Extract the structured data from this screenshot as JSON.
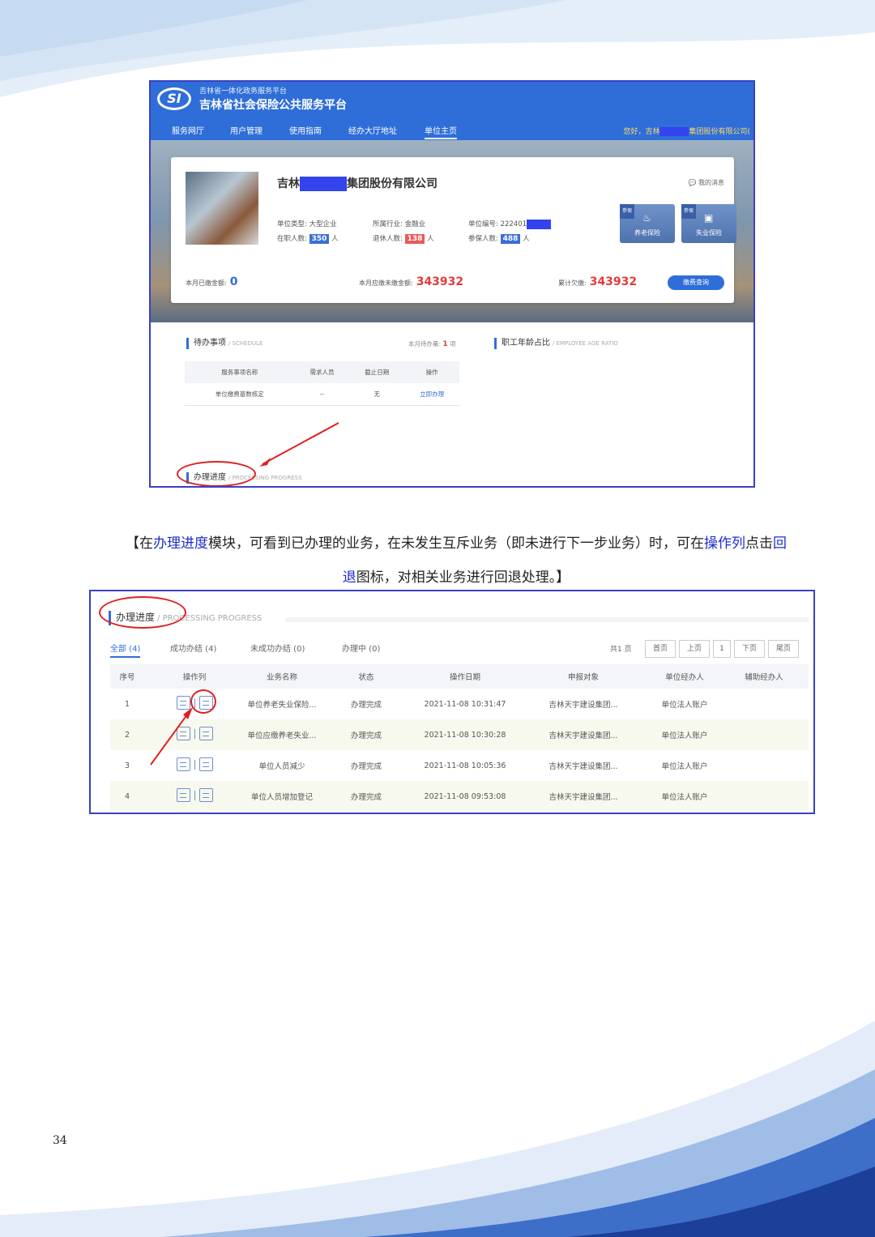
{
  "platform": {
    "subtitle": "吉林省一体化政务服务平台",
    "title": "吉林省社会保险公共服务平台",
    "logo_text": "SI"
  },
  "nav": [
    "服务网厅",
    "用户管理",
    "使用指南",
    "经办大厅地址",
    "单位主页"
  ],
  "greeting": {
    "prefix": "您好，吉林",
    "suffix": "集团股份有限公司("
  },
  "company": {
    "name_prefix": "吉林",
    "name_suffix": "集团股份有限公司",
    "my_message": "我的消息",
    "type_label": "单位类型:",
    "type_value": "大型企业",
    "industry_label": "所属行业:",
    "industry_value": "金融业",
    "code_label": "单位编号:",
    "code_value": "222401",
    "employees_label": "在职人数:",
    "employees_value": "350",
    "person_unit": "人",
    "retired_label": "退休人数:",
    "retired_value": "138",
    "insured_label": "参保人数:",
    "insured_value": "488"
  },
  "insurance_buttons": [
    {
      "label": "养老保险",
      "tag": "参保"
    },
    {
      "label": "失业保险",
      "tag": "参保"
    }
  ],
  "amounts": {
    "paid_label": "本月已缴金额:",
    "paid_value": "0",
    "due_label": "本月应缴未缴金额:",
    "due_value": "343932",
    "arrears_label": "累计欠缴:",
    "arrears_value": "343932",
    "query_btn": "缴费查询"
  },
  "schedule": {
    "title": "待办事项",
    "en": "/ SCHEDULE",
    "count_label": "本月待办量:",
    "count": "1",
    "count_unit": "项",
    "headers": [
      "服务事项名称",
      "需求人员",
      "截止日期",
      "操作"
    ],
    "row": [
      "单位缴费基数核定",
      "--",
      "无",
      "立即办理"
    ]
  },
  "age_ratio": {
    "title": "职工年龄占比",
    "en": "/ EMPLOYEE AGE RATIO"
  },
  "progress1": {
    "title": "办理进度",
    "en": "/ PROCESSING PROGRESS"
  },
  "caption": {
    "line1_parts": [
      "【在",
      "办理进度",
      "模块，可看到已办理的业务，在未发生互斥业务（即未进行下一步业务）时，可在",
      "操作列",
      "点击",
      "回"
    ],
    "line2_parts": [
      "退",
      "图标，对相关业务进行回退处理。】"
    ]
  },
  "progress2": {
    "title": "办理进度",
    "en": "/ PROCESSING PROGRESS",
    "tabs": [
      "全部 (4)",
      "成功办结 (4)",
      "未成功办结 (0)",
      "办理中 (0)"
    ],
    "pager": {
      "total": "共1 页",
      "first": "首页",
      "prev": "上页",
      "page": "1",
      "next": "下页",
      "last": "尾页"
    },
    "headers": [
      "序号",
      "操作列",
      "业务名称",
      "状态",
      "操作日期",
      "申报对象",
      "单位经办人",
      "辅助经办人"
    ],
    "rows": [
      [
        "1",
        "",
        "单位养老失业保险...",
        "办理完成",
        "2021-11-08 10:31:47",
        "吉林天宇建设集团...",
        "单位法人账户",
        ""
      ],
      [
        "2",
        "",
        "单位应缴养老失业...",
        "办理完成",
        "2021-11-08 10:30:28",
        "吉林天宇建设集团...",
        "单位法人账户",
        ""
      ],
      [
        "3",
        "",
        "单位人员减少",
        "办理完成",
        "2021-11-08 10:05:36",
        "吉林天宇建设集团...",
        "单位法人账户",
        ""
      ],
      [
        "4",
        "",
        "单位人员增加登记",
        "办理完成",
        "2021-11-08 09:53:08",
        "吉林天宇建设集团...",
        "单位法人账户",
        ""
      ]
    ]
  },
  "page_number": "34",
  "colors": {
    "accent": "#2f6ed8",
    "highlight": "#e02020",
    "caption_link": "#1d2bd0"
  }
}
